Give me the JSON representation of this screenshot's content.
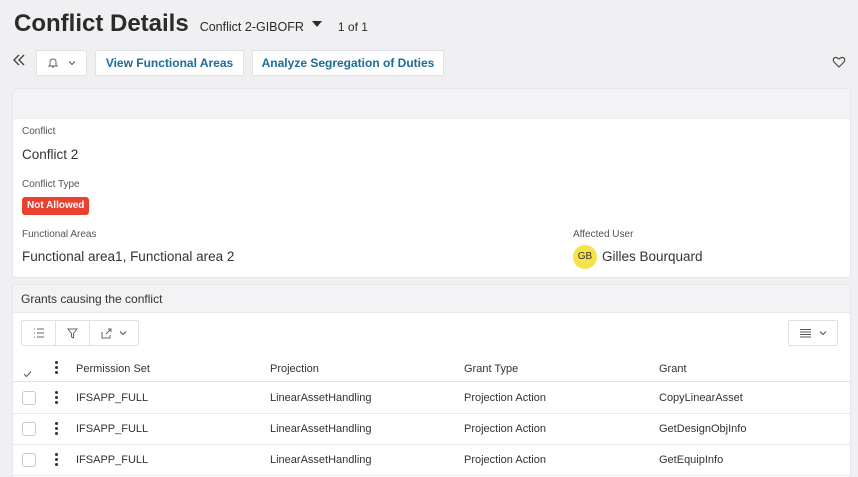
{
  "header": {
    "title": "Conflict Details",
    "record_selector": "Conflict 2-GIBOFR",
    "pager": "1 of 1"
  },
  "toolbar": {
    "view_functional_areas": "View Functional Areas",
    "analyze_segregation": "Analyze Segregation of Duties"
  },
  "details": {
    "conflict_label": "Conflict",
    "conflict_value": "Conflict 2",
    "conflict_type_label": "Conflict Type",
    "conflict_type_value": "Not Allowed",
    "functional_areas_label": "Functional Areas",
    "functional_areas_value": "Functional area1, Functional area 2",
    "affected_user_label": "Affected User",
    "affected_user_initials": "GB",
    "affected_user_name": "Gilles Bourquard"
  },
  "grants": {
    "title": "Grants causing the conflict",
    "columns": [
      "Permission Set",
      "Projection",
      "Grant Type",
      "Grant"
    ],
    "rows": [
      {
        "permission_set": "IFSAPP_FULL",
        "projection": "LinearAssetHandling",
        "grant_type": "Projection Action",
        "grant": "CopyLinearAsset"
      },
      {
        "permission_set": "IFSAPP_FULL",
        "projection": "LinearAssetHandling",
        "grant_type": "Projection Action",
        "grant": "GetDesignObjInfo"
      },
      {
        "permission_set": "IFSAPP_FULL",
        "projection": "LinearAssetHandling",
        "grant_type": "Projection Action",
        "grant": "GetEquipInfo"
      }
    ]
  },
  "colors": {
    "accent": "#1a6c9a",
    "badge_red": "#e8412f",
    "avatar_yellow": "#f4e34a",
    "background": "#f0f0f2"
  },
  "icons": [
    "collapse-icon",
    "bell-icon",
    "chevron-down-icon",
    "heart-icon",
    "list-icon",
    "filter-icon",
    "export-icon",
    "layout-icon",
    "checkmark-icon",
    "kebab-icon"
  ]
}
